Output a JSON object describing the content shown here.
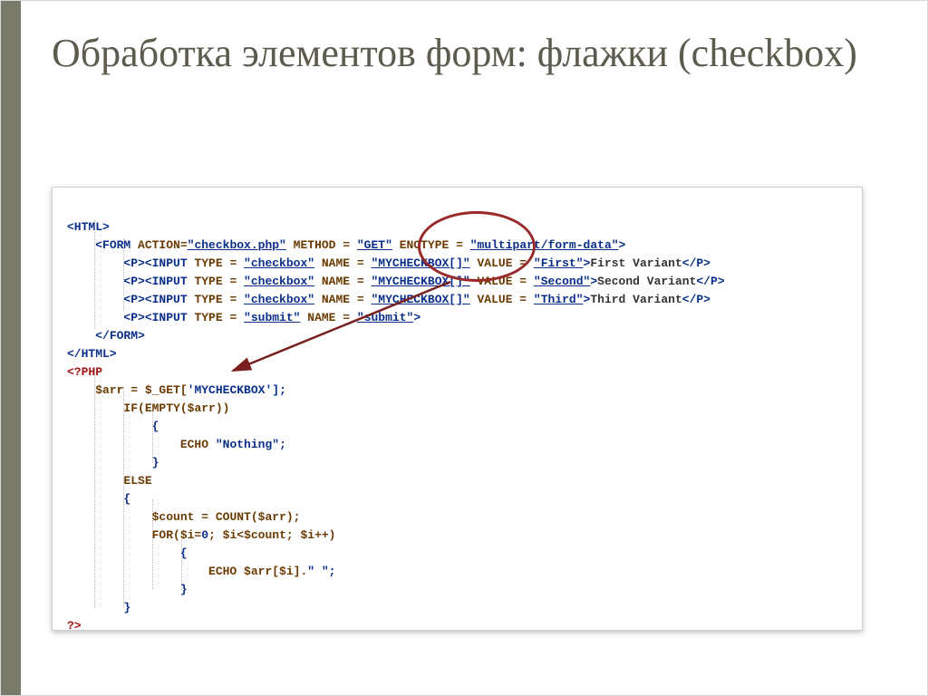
{
  "slide": {
    "title": "Обработка элементов форм: флажки (checkbox)"
  },
  "code": {
    "l01a": "<HTML>",
    "l02a": "<FORM ",
    "l02b": "ACTION=",
    "l02c": "\"checkbox.php\"",
    "l02d": " METHOD = ",
    "l02e": "\"GET\"",
    "l02f": " ENCTYPE = ",
    "l02g": "\"multipart/form-data\"",
    "l02h": ">",
    "l03a": "<P><INPUT ",
    "l03b": "TYPE = ",
    "l03c": "\"checkbox\"",
    "l03d": " NAME = ",
    "l03e": "\"MYCHECKBOX[]\"",
    "l03f": " VALUE = ",
    "l03g": "\"First\"",
    "l03h": ">",
    "l03i": "First Variant",
    "l03j": "</P>",
    "l04a": "<P><INPUT ",
    "l04b": "TYPE = ",
    "l04c": "\"checkbox\"",
    "l04d": " NAME = ",
    "l04e": "\"MYCHECKBOX[]\"",
    "l04f": " VALUE = ",
    "l04g": "\"Second\"",
    "l04h": ">",
    "l04i": "Second Variant",
    "l04j": "</P>",
    "l05a": "<P><INPUT ",
    "l05b": "TYPE = ",
    "l05c": "\"checkbox\"",
    "l05d": " NAME = ",
    "l05e": "\"MYCHECKBOX[]\"",
    "l05f": " VALUE = ",
    "l05g": "\"Third\"",
    "l05h": ">",
    "l05i": "Third Variant",
    "l05j": "</P>",
    "l06a": "<P><INPUT ",
    "l06b": "TYPE = ",
    "l06c": "\"submit\"",
    "l06d": " NAME = ",
    "l06e": "\"submit\"",
    "l06f": ">",
    "l07a": "</FORM>",
    "l08a": "</HTML>",
    "l09a": "<?PHP",
    "l10a": "$arr = $_GET[",
    "l10b": "'MYCHECKBOX'",
    "l10c": "];",
    "l11a": "IF(",
    "l11b": "EMPTY",
    "l11c": "($arr))",
    "l12a": "{",
    "l13a": "ECHO ",
    "l13b": "\"Nothing\"",
    "l13c": ";",
    "l14a": "}",
    "l15a": "ELSE",
    "l16a": "{",
    "l17a": "$count = ",
    "l17b": "COUNT",
    "l17c": "($arr);",
    "l18a": "FOR",
    "l18b": "($i=",
    "l18c": "0",
    "l18d": "; $i<$count; $i++)",
    "l19a": "{",
    "l20a": "ECHO ",
    "l20b": "$arr[$i].",
    "l20c": "\" \"",
    "l20d": ";",
    "l21a": "}",
    "l22a": "}",
    "l23a": "?>"
  }
}
